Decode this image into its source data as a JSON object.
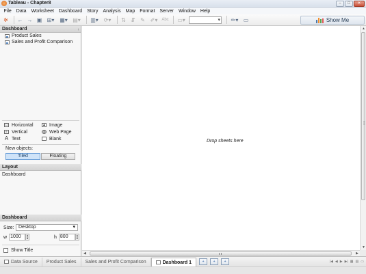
{
  "window": {
    "title": "Tableau - Chapter8"
  },
  "menu": [
    "File",
    "Data",
    "Worksheet",
    "Dashboard",
    "Story",
    "Analysis",
    "Map",
    "Format",
    "Server",
    "Window",
    "Help"
  ],
  "toolbar": {
    "show_me_label": "Show Me"
  },
  "dashboard_pane": {
    "header": "Dashboard",
    "sheets": [
      "Product Sales",
      "Sales and Profit Comparison"
    ]
  },
  "objects": {
    "items": [
      {
        "label": "Horizontal",
        "icon": "horizontal-container-icon"
      },
      {
        "label": "Image",
        "icon": "image-icon"
      },
      {
        "label": "Vertical",
        "icon": "vertical-container-icon"
      },
      {
        "label": "Web Page",
        "icon": "globe-icon"
      },
      {
        "label": "Text",
        "icon": "text-icon"
      },
      {
        "label": "Blank",
        "icon": "blank-icon"
      }
    ],
    "new_objects_label": "New objects:",
    "tiled_label": "Tiled",
    "floating_label": "Floating"
  },
  "layout_pane": {
    "header": "Layout",
    "item": "Dashboard"
  },
  "dashboard_settings": {
    "header": "Dashboard",
    "size_label": "Size:",
    "size_value": "Desktop",
    "w_label": "w",
    "w_value": "1000",
    "h_label": "h",
    "h_value": "800",
    "show_title_label": "Show Title"
  },
  "canvas": {
    "placeholder": "Drop sheets here"
  },
  "tabs": [
    {
      "label": "Data Source",
      "active": false
    },
    {
      "label": "Product Sales",
      "active": false
    },
    {
      "label": "Sales and Profit Comparison",
      "active": false
    },
    {
      "label": "Dashboard 1",
      "active": true
    }
  ],
  "colors": {
    "show_me_bars": [
      "#4e79a7",
      "#f28e2b",
      "#59a14f",
      "#e15759"
    ],
    "tiled_active": "#cfe3f8"
  }
}
